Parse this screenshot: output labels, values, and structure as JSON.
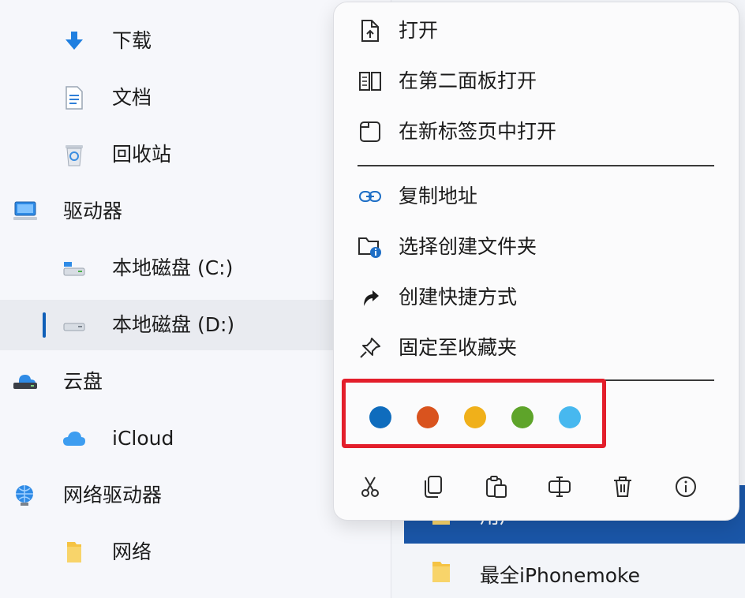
{
  "sidebar": {
    "items": [
      {
        "label": "下载",
        "icon": "download-icon",
        "level": 2
      },
      {
        "label": "文档",
        "icon": "document-icon",
        "level": 2
      },
      {
        "label": "回收站",
        "icon": "recycle-bin-icon",
        "level": 2
      },
      {
        "label": "驱动器",
        "icon": "computer-icon",
        "level": 1
      },
      {
        "label": "本地磁盘 (C:)",
        "icon": "drive-c-icon",
        "level": 2
      },
      {
        "label": "本地磁盘 (D:)",
        "icon": "drive-d-icon",
        "level": 2,
        "selected": true
      },
      {
        "label": "云盘",
        "icon": "cloud-drive-icon",
        "level": 1
      },
      {
        "label": "iCloud",
        "icon": "icloud-icon",
        "level": 2
      },
      {
        "label": "网络驱动器",
        "icon": "network-drive-icon",
        "level": 1
      },
      {
        "label": "网络",
        "icon": "network-folder-icon",
        "level": 2
      }
    ]
  },
  "file_list": {
    "selected_row_label": "用户",
    "row_label": "最全iPhonemoke"
  },
  "context_menu": {
    "items": [
      {
        "label": "打开",
        "icon": "open-file-icon"
      },
      {
        "label": "在第二面板打开",
        "icon": "second-panel-icon"
      },
      {
        "label": "在新标签页中打开",
        "icon": "new-tab-icon"
      },
      {
        "label": "复制地址",
        "icon": "link-icon"
      },
      {
        "label": "选择创建文件夹",
        "icon": "folder-info-icon"
      },
      {
        "label": "创建快捷方式",
        "icon": "shortcut-arrow-icon"
      },
      {
        "label": "固定至收藏夹",
        "icon": "pin-icon"
      }
    ],
    "color_tags": [
      "#0f6cbd",
      "#d9531e",
      "#f0b01a",
      "#5ea42a",
      "#47b8ef"
    ],
    "actions": [
      {
        "name": "cut",
        "icon": "scissors-icon"
      },
      {
        "name": "copy",
        "icon": "copy-icon"
      },
      {
        "name": "paste",
        "icon": "paste-icon"
      },
      {
        "name": "rename",
        "icon": "rename-icon"
      },
      {
        "name": "delete",
        "icon": "trash-icon"
      },
      {
        "name": "properties",
        "icon": "info-icon"
      }
    ]
  },
  "colors": {
    "accent": "#0f5fb8",
    "highlight_border": "#e31e2b",
    "selected_row_bg": "#1a56a7"
  }
}
